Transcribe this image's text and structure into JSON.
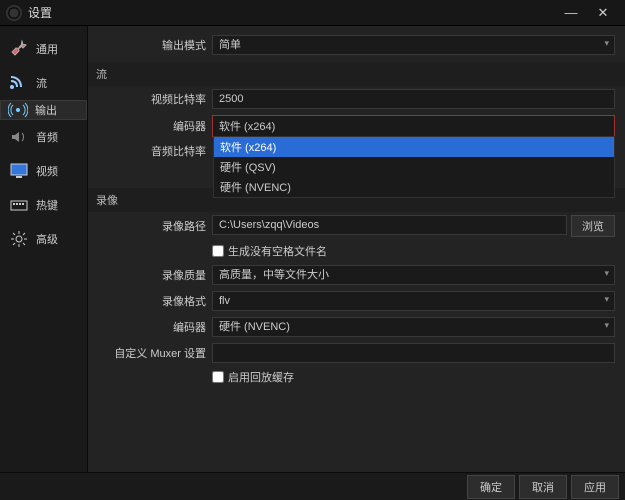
{
  "window": {
    "title": "设置",
    "min": "—",
    "close": "✕"
  },
  "sidebar": {
    "items": [
      {
        "label": "通用"
      },
      {
        "label": "流"
      },
      {
        "label": "输出"
      },
      {
        "label": "音频"
      },
      {
        "label": "视频"
      },
      {
        "label": "热键"
      },
      {
        "label": "高级"
      }
    ]
  },
  "output": {
    "mode_label": "输出模式",
    "mode_value": "简单",
    "stream_header": "流",
    "vbitrate_label": "视频比特率",
    "vbitrate_value": "2500",
    "encoder_label": "编码器",
    "encoder_value": "软件 (x264)",
    "encoder_options": [
      "软件 (x264)",
      "硬件 (QSV)",
      "硬件 (NVENC)"
    ],
    "abitrate_label": "音频比特率",
    "rec_header": "录像",
    "rec_path_label": "录像路径",
    "rec_path_value": "C:\\Users\\zqq\\Videos",
    "browse": "浏览",
    "gen_nospace_label": "生成没有空格文件名",
    "rec_quality_label": "录像质量",
    "rec_quality_value": "高质量，中等文件大小",
    "rec_format_label": "录像格式",
    "rec_format_value": "flv",
    "rec_encoder_label": "编码器",
    "rec_encoder_value": "硬件 (NVENC)",
    "muxer_label": "自定义 Muxer 设置",
    "replay_label": "启用回放缓存"
  },
  "buttons": {
    "ok": "确定",
    "cancel": "取消",
    "apply": "应用"
  }
}
